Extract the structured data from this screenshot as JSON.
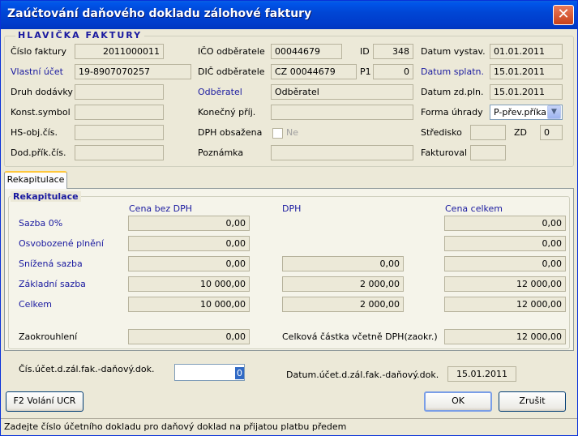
{
  "window": {
    "title": "Zaúčtování daňového dokladu zálohové faktury",
    "close_glyph": "✕"
  },
  "header_group": {
    "title": "HLAVIČKA FAKTURY"
  },
  "header": {
    "cislo_faktury_label": "Číslo faktury",
    "cislo_faktury_value": "2011000011",
    "vlastni_ucet_label": "Vlastní účet",
    "vlastni_ucet_value": "19-8907070257",
    "druh_dodavky_label": "Druh dodávky",
    "konst_symbol_label": "Konst.symbol",
    "hs_obj_label": "HS-obj.čís.",
    "dod_prik_label": "Dod.přík.čís.",
    "ico_label": "IČO odběratele",
    "ico_value": "00044679",
    "id_label": "ID",
    "id_value": "348",
    "dic_label": "DIČ odběratele",
    "dic_value": "CZ 00044679",
    "p1_label": "P1",
    "p1_value": "0",
    "odberatel_label": "Odběratel",
    "odberatel_value": "Odběratel",
    "konecny_label": "Konečný příj.",
    "dph_obsazena_label": "DPH obsažena",
    "dph_obsazena_value": "Ne",
    "poznamka_label": "Poznámka",
    "datum_vystav_label": "Datum vystav.",
    "datum_vystav_value": "01.01.2011",
    "datum_splatn_label": "Datum splatn.",
    "datum_splatn_value": "15.01.2011",
    "datum_zd_label": "Datum zd.pln.",
    "datum_zd_value": "15.01.2011",
    "forma_uhrady_label": "Forma úhrady",
    "forma_uhrady_value": "P-přev.příka",
    "stredisko_label": "Středisko",
    "zd_label": "ZD",
    "zd_value": "0",
    "fakturoval_label": "Fakturoval"
  },
  "tabs": [
    {
      "label": "Rekapitulace"
    }
  ],
  "recap": {
    "group_title": "Rekapitulace",
    "col_bez_dph": "Cena bez DPH",
    "col_dph": "DPH",
    "col_celkem": "Cena celkem",
    "rows": {
      "sazba0": {
        "label": "Sazba 0%",
        "bez": "0,00",
        "celkem": "0,00"
      },
      "osvob": {
        "label": "Osvobozené plnění",
        "bez": "0,00",
        "celkem": "0,00"
      },
      "snizena": {
        "label": "Snížená sazba",
        "bez": "0,00",
        "dph": "0,00",
        "celkem": "0,00"
      },
      "zakladni": {
        "label": "Základní sazba",
        "bez": "10 000,00",
        "dph": "2 000,00",
        "celkem": "12 000,00"
      },
      "celkem": {
        "label": "Celkem",
        "bez": "10 000,00",
        "dph": "2 000,00",
        "celkem": "12 000,00"
      }
    },
    "zaokrouhleni_label": "Zaokrouhlení",
    "zaokrouhleni_value": "0,00",
    "celkova_label": "Celková částka včetně DPH(zaokr.)",
    "celkova_value": "12 000,00"
  },
  "bottom": {
    "cis_ucet_label": "Čís.účet.d.zál.fak.-daňový.dok.",
    "cis_ucet_value": "0",
    "datum_ucet_label": "Datum.účet.d.zál.fak.-daňový.dok.",
    "datum_ucet_value": "15.01.2011"
  },
  "buttons": {
    "f2": "F2 Volání UCR",
    "ok": "OK",
    "cancel": "Zrušit"
  },
  "status": {
    "text": "Zadejte číslo účetního dokladu pro daňový doklad na přijatou platbu předem"
  },
  "icons": {
    "combo_arrow": "▼"
  },
  "colors": {
    "titlebar": "#0046d5",
    "link_label": "#1a1aa0",
    "selection": "#316ac5"
  }
}
